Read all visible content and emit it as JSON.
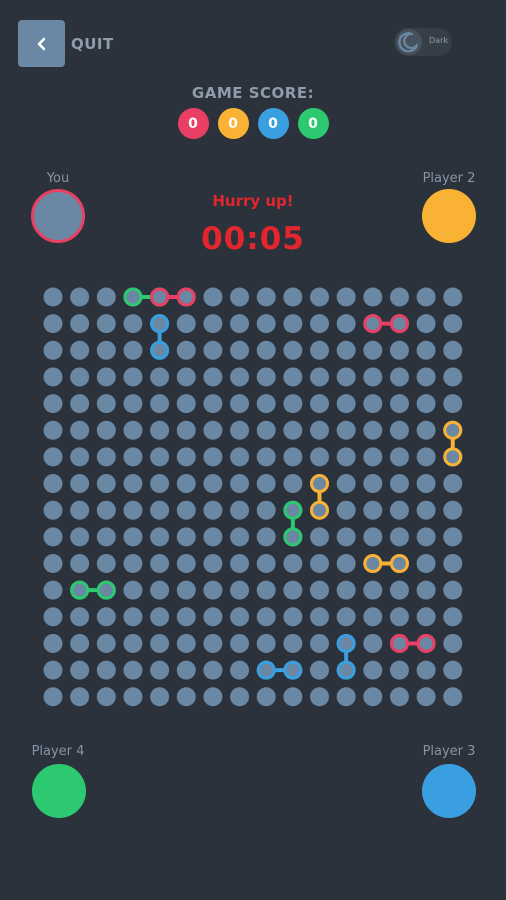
{
  "header": {
    "quit_label": "QUIT",
    "back_icon": "chevron-left-icon",
    "theme_label": "Dark",
    "theme_icon": "moon-icon"
  },
  "score": {
    "title": "GAME SCORE:",
    "values": [
      {
        "value": "0",
        "color": "#ea3f65"
      },
      {
        "value": "0",
        "color": "#f9b233"
      },
      {
        "value": "0",
        "color": "#3a9fe0"
      },
      {
        "value": "0",
        "color": "#2dc970"
      }
    ]
  },
  "players": {
    "you": {
      "label": "You",
      "color": "#6a87a3"
    },
    "p2": {
      "label": "Player 2",
      "color": "#f9b233"
    },
    "p3": {
      "label": "Player 3",
      "color": "#3a9fe0"
    },
    "p4": {
      "label": "Player 4",
      "color": "#2dc970"
    }
  },
  "status": {
    "message": "Hurry up!",
    "timer": "00:05"
  },
  "colors": {
    "dot": "#6a87a3",
    "red": "#ea3f65",
    "yellow": "#f9b233",
    "blue": "#3a9fe0",
    "green": "#2dc970"
  },
  "board": {
    "columns": 16,
    "rows": 16,
    "lines": [
      {
        "from": [
          3,
          0
        ],
        "to": [
          4,
          0
        ],
        "color": "green"
      },
      {
        "from": [
          4,
          0
        ],
        "to": [
          5,
          0
        ],
        "color": "red"
      },
      {
        "from": [
          4,
          1
        ],
        "to": [
          4,
          2
        ],
        "color": "blue"
      },
      {
        "from": [
          12,
          1
        ],
        "to": [
          13,
          1
        ],
        "color": "red"
      },
      {
        "from": [
          15,
          5
        ],
        "to": [
          15,
          6
        ],
        "color": "yellow"
      },
      {
        "from": [
          10,
          7
        ],
        "to": [
          10,
          8
        ],
        "color": "yellow"
      },
      {
        "from": [
          9,
          8
        ],
        "to": [
          9,
          9
        ],
        "color": "green"
      },
      {
        "from": [
          12,
          10
        ],
        "to": [
          13,
          10
        ],
        "color": "yellow"
      },
      {
        "from": [
          1,
          11
        ],
        "to": [
          2,
          11
        ],
        "color": "green"
      },
      {
        "from": [
          13,
          13
        ],
        "to": [
          14,
          13
        ],
        "color": "red"
      },
      {
        "from": [
          11,
          13
        ],
        "to": [
          11,
          14
        ],
        "color": "blue"
      },
      {
        "from": [
          8,
          14
        ],
        "to": [
          9,
          14
        ],
        "color": "blue"
      }
    ]
  }
}
